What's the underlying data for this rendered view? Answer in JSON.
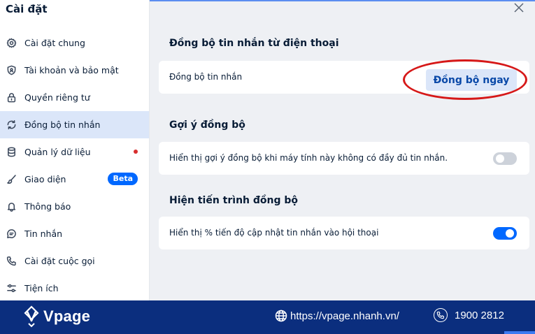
{
  "sidebar": {
    "title": "Cài đặt",
    "items": [
      {
        "label": "Cài đặt chung",
        "icon": "gear-icon"
      },
      {
        "label": "Tài khoản và bảo mật",
        "icon": "shield-icon"
      },
      {
        "label": "Quyền riêng tư",
        "icon": "lock-icon"
      },
      {
        "label": "Đồng bộ tin nhắn",
        "icon": "sync-icon",
        "active": true
      },
      {
        "label": "Quản lý dữ liệu",
        "icon": "database-icon",
        "dot": true
      },
      {
        "label": "Giao diện",
        "icon": "brush-icon",
        "badge": "Beta"
      },
      {
        "label": "Thông báo",
        "icon": "bell-icon"
      },
      {
        "label": "Tin nhắn",
        "icon": "message-icon"
      },
      {
        "label": "Cài đặt cuộc gọi",
        "icon": "phone-icon"
      },
      {
        "label": "Tiện ích",
        "icon": "sliders-icon"
      }
    ]
  },
  "main": {
    "sections": [
      {
        "title": "Đồng bộ tin nhắn từ điện thoại",
        "row_text": "Đồng bộ tin nhắn",
        "button_label": "Đồng bộ ngay"
      },
      {
        "title": "Gợi ý đồng bộ",
        "row_text": "Hiển thị gợi ý đồng bộ khi máy tính này không có đầy đủ tin nhắn.",
        "toggle_on": false
      },
      {
        "title": "Hiện tiến trình đồng bộ",
        "row_text": "Hiển thị % tiến độ cập nhật tin nhắn vào hội thoại",
        "toggle_on": true
      }
    ]
  },
  "footer": {
    "brand": "Vpage",
    "website": "https://vpage.nhanh.vn/",
    "phone": "1900 2812"
  },
  "colors": {
    "accent": "#0068ff",
    "footer_bg": "#0b2e7e",
    "annotation": "#d61818"
  }
}
